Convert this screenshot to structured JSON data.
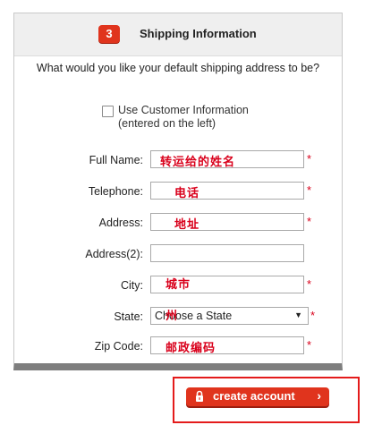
{
  "section": {
    "step_number": "3",
    "title": "Shipping Information",
    "question": "What would you like your default shipping address to be?",
    "use_customer_line1": "Use Customer Information",
    "use_customer_line2": "(entered on the left)",
    "use_customer_checked": false
  },
  "fields": {
    "full_name": {
      "label": "Full Name:",
      "value": "转运给的姓名",
      "required": "*"
    },
    "telephone": {
      "label": "Telephone:",
      "value": "电话",
      "required": "*"
    },
    "address": {
      "label": "Address:",
      "value": "地址",
      "required": "*"
    },
    "address2": {
      "label": "Address(2):",
      "value": ""
    },
    "city": {
      "label": "City:",
      "value": "城市",
      "required": "*"
    },
    "state": {
      "label": "State:",
      "selected": "Choose a State",
      "overlay": "州",
      "required": "*"
    },
    "zip": {
      "label": "Zip Code:",
      "value": "邮政编码",
      "required": "*"
    }
  },
  "cta": {
    "label": "create account",
    "icon": "lock-icon",
    "chevron": "›"
  },
  "colors": {
    "accent_red": "#e0341d",
    "required_red": "#d9001b",
    "highlight_frame": "#e41b1b",
    "header_bg": "#efefef"
  }
}
